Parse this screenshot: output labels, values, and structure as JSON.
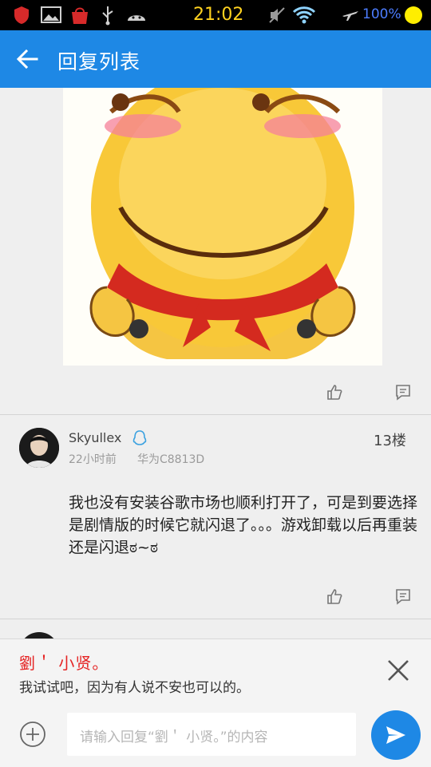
{
  "status_bar": {
    "time": "21:02",
    "battery_percent": "100%",
    "icons": [
      "shield-icon",
      "image-icon",
      "bag-icon",
      "usb-icon",
      "android-icon",
      "mute-icon",
      "wifi-icon",
      "airplane-icon",
      "battery-icon"
    ]
  },
  "app_bar": {
    "title": "回复列表",
    "back_icon": "arrow-left-icon"
  },
  "posts": [
    {
      "type": "image",
      "image_desc": "smiling emoji with red scarf",
      "actions": [
        "like-icon",
        "comment-icon"
      ]
    },
    {
      "username": "Skyullex",
      "badge_icon": "qq-penguin-icon",
      "floor": "13楼",
      "time_ago": "22小时前",
      "device": "华为C8813D",
      "text": "我也没有安装谷歌市场也顺利打开了，可是到要选择是剧情版的时候它就闪退了。。。游戏卸载以后再重装还是闪退ಠ~ಠ",
      "actions": [
        "like-icon",
        "comment-icon"
      ]
    }
  ],
  "reply_panel": {
    "target_name": "劉＇ 小贤。",
    "quote": "我试试吧，因为有人说不安也可以的。",
    "placeholder": "请输入回复“劉＇ 小贤。”的内容",
    "icons": [
      "close-icon",
      "add-icon",
      "send-icon"
    ]
  },
  "colors": {
    "app_bar": "#1e88e5",
    "accent_name": "#e52323",
    "status_time": "#ffd21f",
    "status_batt": "#4c7dff"
  }
}
